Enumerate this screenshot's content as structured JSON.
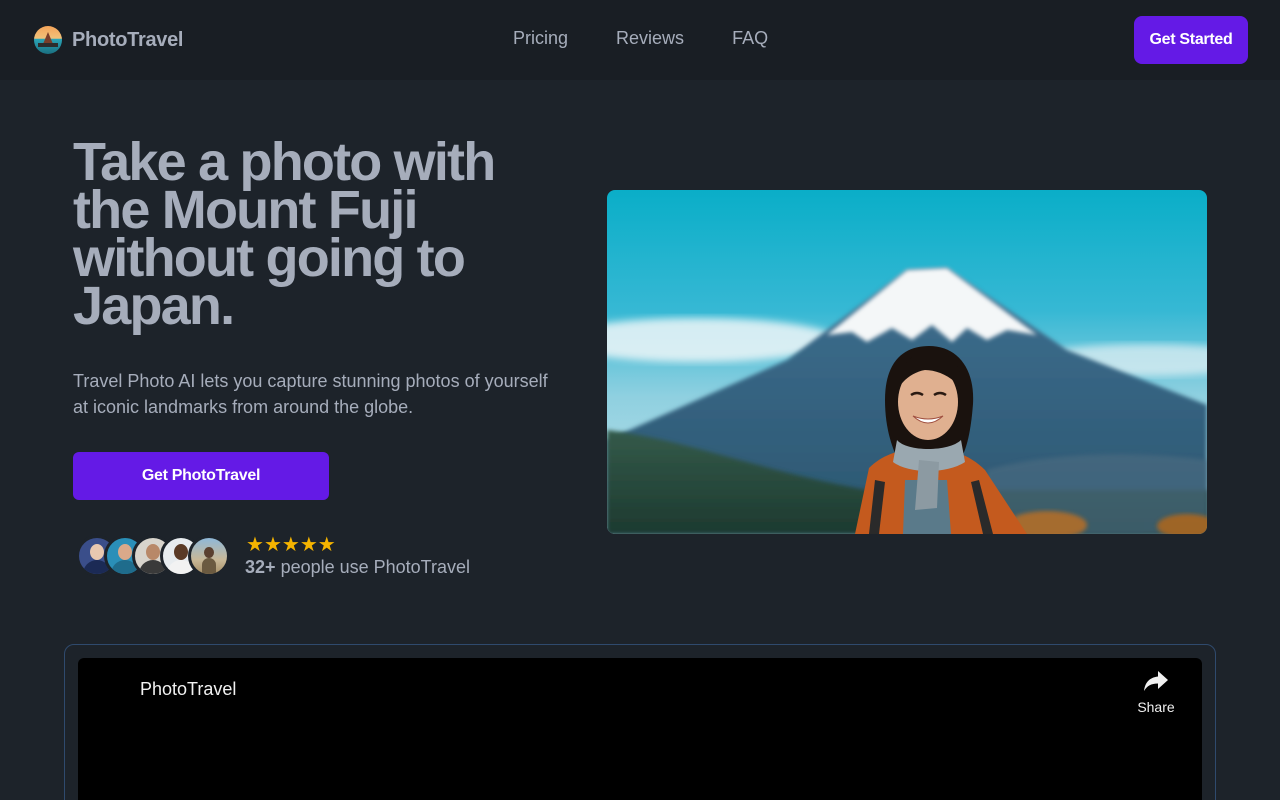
{
  "nav": {
    "brand": "PhotoTravel",
    "links": [
      "Pricing",
      "Reviews",
      "FAQ"
    ],
    "cta": "Get Started"
  },
  "hero": {
    "headline": "Take a photo with the Mount Fuji without going to Japan.",
    "subtext": "Travel Photo AI lets you capture stunning photos of yourself at iconic landmarks from around the globe.",
    "cta": "Get PhotoTravel",
    "rating_stars": 5,
    "user_count": "32+",
    "user_text": "people use PhotoTravel"
  },
  "video": {
    "title": "PhotoTravel",
    "share_label": "Share"
  },
  "colors": {
    "background": "#1d232a",
    "nav_background": "#191e24",
    "primary": "#641ae6",
    "text": "#a6adbb",
    "star": "#f5b400"
  }
}
